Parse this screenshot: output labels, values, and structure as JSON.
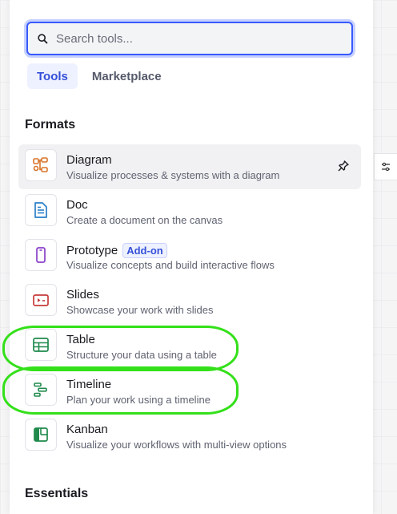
{
  "search": {
    "placeholder": "Search tools..."
  },
  "tabs": [
    {
      "label": "Tools",
      "active": true
    },
    {
      "label": "Marketplace",
      "active": false
    }
  ],
  "sections": {
    "formats": "Formats",
    "essentials": "Essentials"
  },
  "items": [
    {
      "name": "Diagram",
      "desc": "Visualize processes & systems with a diagram",
      "icon": "diagram-icon",
      "color": "#d8742a"
    },
    {
      "name": "Doc",
      "desc": "Create a document on the canvas",
      "icon": "doc-icon",
      "color": "#2a7fc9"
    },
    {
      "name": "Prototype",
      "badge": "Add-on",
      "desc": "Visualize concepts and build interactive flows",
      "icon": "prototype-icon",
      "color": "#8a3fc9"
    },
    {
      "name": "Slides",
      "desc": "Showcase your work with slides",
      "icon": "slides-icon",
      "color": "#c83a3a"
    },
    {
      "name": "Table",
      "desc": "Structure your data using a table",
      "icon": "table-icon",
      "color": "#1f8a4c"
    },
    {
      "name": "Timeline",
      "desc": "Plan your work using a timeline",
      "icon": "timeline-icon",
      "color": "#1f8a4c"
    },
    {
      "name": "Kanban",
      "desc": "Visualize your workflows with multi-view options",
      "icon": "kanban-icon",
      "color": "#1f8a4c"
    }
  ],
  "colors": {
    "accent": "#3859ff",
    "highlight": "#33e019"
  }
}
